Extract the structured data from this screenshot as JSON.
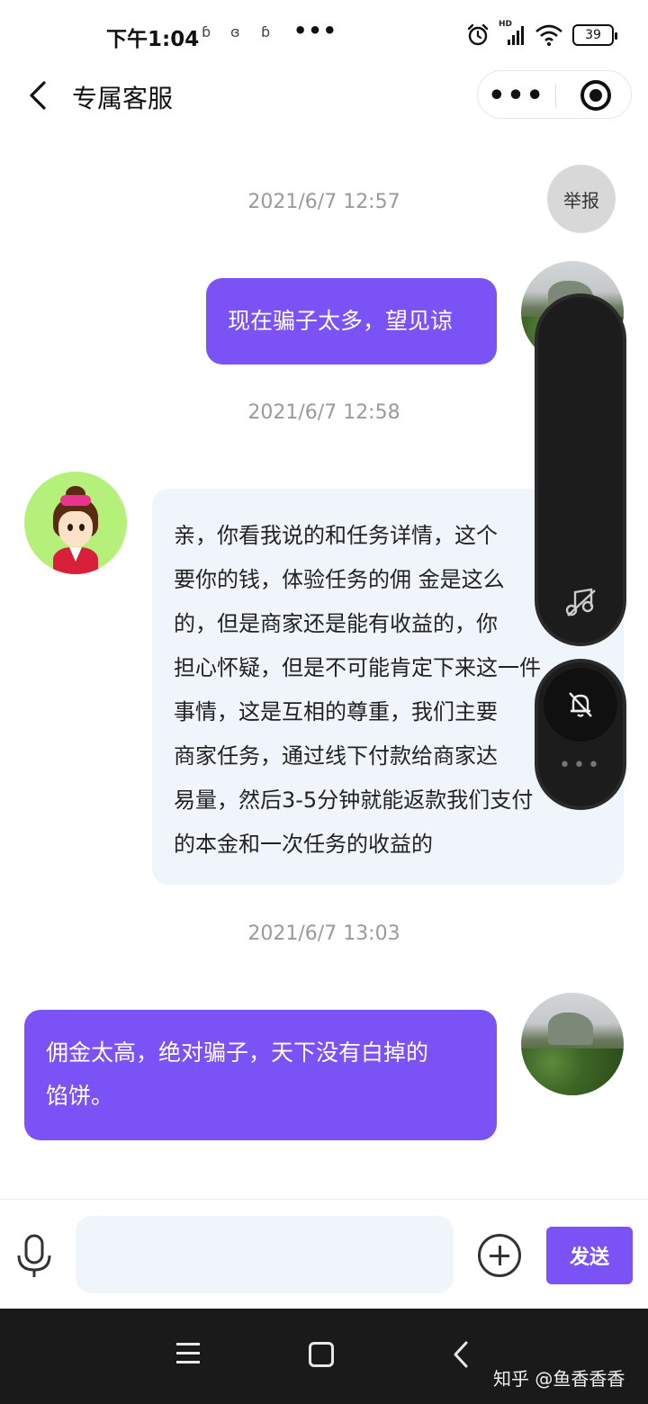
{
  "status_bar": {
    "time": "下午1:04",
    "notifications": [
      "ɓ",
      "ɞ",
      "ɓ"
    ],
    "overflow": "•••",
    "network_label": "HD",
    "battery": "39"
  },
  "nav": {
    "title": "专属客服",
    "back_icon": "chevron-left-icon",
    "more_label": "•••",
    "close_icon": "target-icon"
  },
  "report_label": "举报",
  "messages": [
    {
      "timestamp": "2021/6/7 12:57",
      "sender": "user",
      "text": "现在骗子太多，望见谅"
    },
    {
      "timestamp": "2021/6/7 12:58",
      "sender": "service",
      "lines": [
        "亲，你看我说的和任务详情，这个",
        "要你的钱，体验任务的佣 金是这么",
        "的，但是商家还是能有收益的，你",
        "担心怀疑，但是不可能肯定下来这一件",
        "事情，这是互相的尊重，我们主要",
        "商家任务，通过线下付款给商家达",
        "易量，然后3-5分钟就能返款我们支付",
        "的本金和一次任务的收益的"
      ]
    },
    {
      "timestamp": "2021/6/7 13:03",
      "sender": "user",
      "lines": [
        "佣金太高，绝对骗子，天下没有白掉的",
        "馅饼。"
      ]
    }
  ],
  "overlay": {
    "more_label": "•••"
  },
  "input": {
    "value": "",
    "placeholder": "",
    "send_label": "发送"
  },
  "watermark": "知乎 @鱼香香香",
  "colors": {
    "accent": "#7b52f5",
    "incoming_bubble": "#f0f5fb",
    "system_nav": "#1a1a1a"
  }
}
